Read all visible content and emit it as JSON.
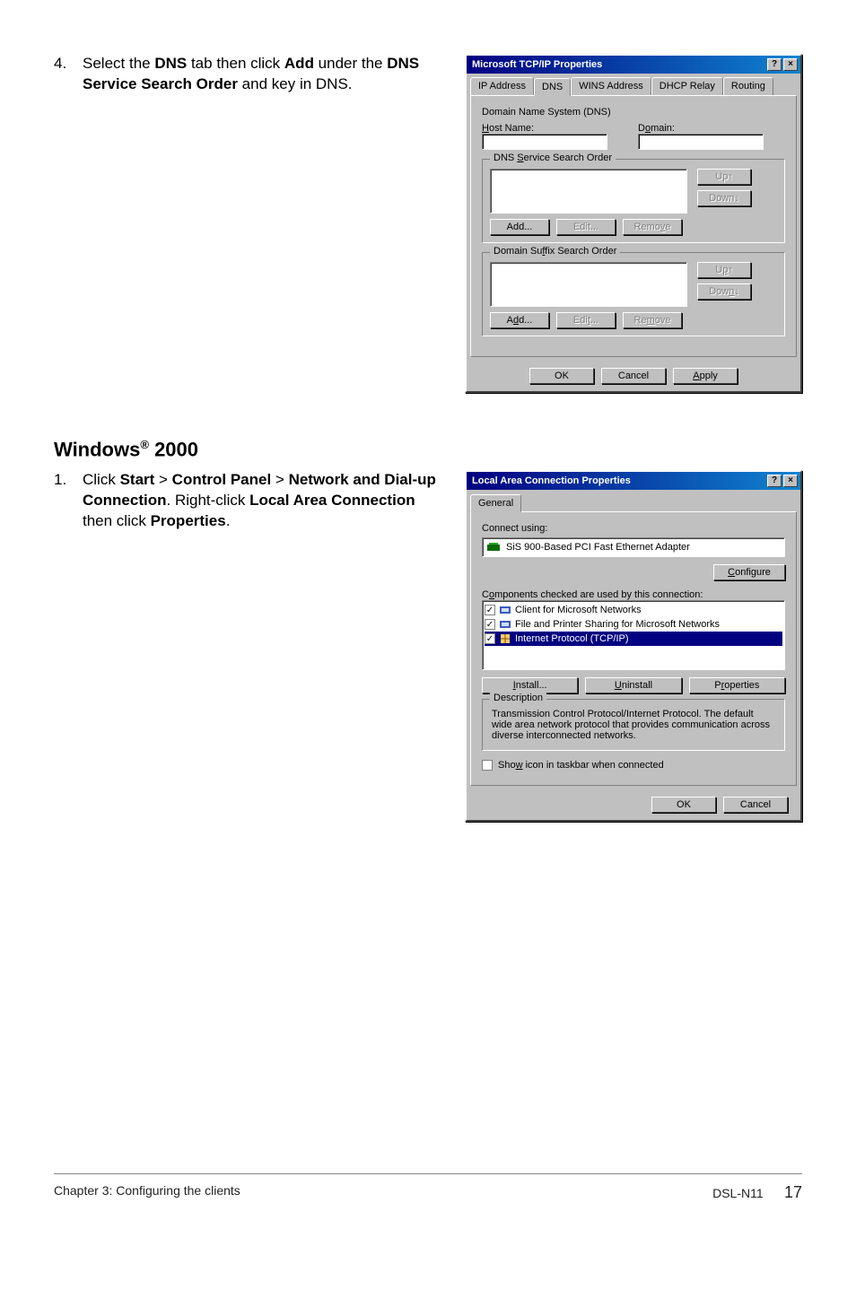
{
  "step4": {
    "num": "4.",
    "text_parts": [
      "Select the ",
      " tab then click ",
      " under the ",
      " and key in DNS."
    ],
    "bold": [
      "DNS",
      "Add",
      "DNS Service Search Order"
    ]
  },
  "heading_win2000": "Windows® 2000",
  "step1": {
    "num": "1.",
    "text_parts": [
      "Click ",
      " > ",
      " > ",
      ". Right-click ",
      " then click ",
      "."
    ],
    "bold": [
      "Start",
      "Control Panel",
      "Network and Dial-up Connection",
      "Local Area Connection",
      "Properties"
    ]
  },
  "dlg_tcp": {
    "title": "Microsoft TCP/IP Properties",
    "tabs": [
      "IP Address",
      "DNS",
      "WINS Address",
      "DHCP Relay",
      "Routing"
    ],
    "dns_system": "Domain Name System (DNS)",
    "host_label": "Host Name:",
    "domain_label": "Domain:",
    "group1": "DNS Service Search Order",
    "group2": "Domain Suffix Search Order",
    "btn_up": "Up↑",
    "btn_down": "Down↓",
    "btn_add": "Add...",
    "btn_edit": "Edit...",
    "btn_remove": "Remove",
    "btn_ok": "OK",
    "btn_cancel": "Cancel",
    "btn_apply": "Apply"
  },
  "dlg_lac": {
    "title": "Local Area Connection Properties",
    "tab_general": "General",
    "connect_using": "Connect using:",
    "adapter": "SiS 900-Based PCI Fast Ethernet Adapter",
    "btn_configure": "Configure",
    "components_label": "Components checked are used by this connection:",
    "items": [
      "Client for Microsoft Networks",
      "File and Printer Sharing for Microsoft Networks",
      "Internet Protocol (TCP/IP)"
    ],
    "btn_install": "Install...",
    "btn_uninstall": "Uninstall",
    "btn_properties": "Properties",
    "desc_legend": "Description",
    "desc_text": "Transmission Control Protocol/Internet Protocol. The default wide area network protocol that provides communication across diverse interconnected networks.",
    "show_icon": "Show icon in taskbar when connected",
    "btn_ok": "OK",
    "btn_cancel": "Cancel"
  },
  "footer": {
    "left": "Chapter 3: Configuring the clients",
    "mid": "DSL-N11",
    "page": "17"
  }
}
